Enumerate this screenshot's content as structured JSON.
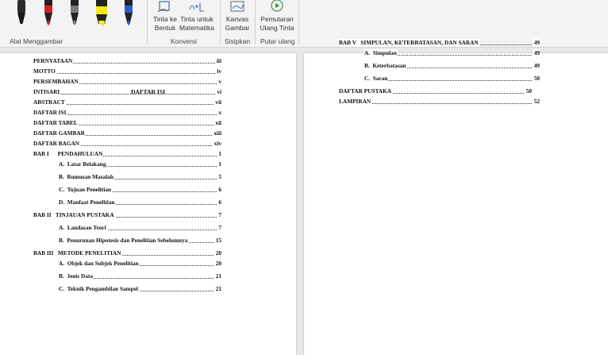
{
  "ribbon": {
    "pens": [
      {
        "icon": "black-pen-icon",
        "color": "#1a1a1a"
      },
      {
        "icon": "red-pen-icon",
        "color": "#d42020"
      },
      {
        "icon": "gray-pen-icon",
        "color": "#6e6e6e"
      },
      {
        "icon": "yellow-highlighter-icon",
        "color": "#f4e81a"
      },
      {
        "icon": "blue-pen-icon",
        "color": "#2a5bd7"
      }
    ],
    "groups": {
      "drawing_tools": "Alat Menggambar",
      "convert": "Konversi",
      "insert": "Sisipkan",
      "replay": "Putar ulang"
    },
    "buttons": {
      "ink_to_shape": "Tinta ke\nBentuk",
      "ink_to_math": "Tinta untuk\nMatematika",
      "canvas": "Kanvas\nGambar",
      "ink_replay": "Pemutaran\nUlang Tinta"
    }
  },
  "left_page": {
    "title": "DAFTAR ISI",
    "entries": [
      {
        "label": "PERNYATAAN",
        "page": "iii"
      },
      {
        "label": "MOTTO",
        "page": "iv"
      },
      {
        "label": "PERSEMBAHAN",
        "page": "v"
      },
      {
        "label": "INTISARI",
        "page": "vi"
      },
      {
        "label": "ABSTRACT",
        "page": "vii"
      },
      {
        "label": "DAFTAR ISI",
        "page": "x"
      },
      {
        "label": "DAFTAR TABEL",
        "page": "xii"
      },
      {
        "label": "DAFTAR GAMBAR",
        "page": "xiii"
      },
      {
        "label": "DAFTAR BAGAN",
        "page": "xiv"
      },
      {
        "label": "BAB I      PENDAHULUAN",
        "page": "1"
      },
      {
        "label": "A.  Latar Belakang",
        "page": "1"
      },
      {
        "label": "B.  Rumusan Masalah",
        "page": "5"
      },
      {
        "label": "C.  Tujuan Penelitian",
        "page": "6"
      },
      {
        "label": "D.  Manfaat Penelitian",
        "page": "6"
      },
      {
        "label": "BAB II   TINJAUAN PUSTAKA",
        "page": "7"
      },
      {
        "label": "A.  Landasan Teori",
        "page": "7"
      },
      {
        "label": "B.  Penurunan Hipotesis dan Penelitian Sebelumnya",
        "page": "15"
      },
      {
        "label": "BAB III   METODE PENELITIAN",
        "page": "20"
      },
      {
        "label": "A.  Objek dan Subjek Penelitian",
        "page": "20"
      },
      {
        "label": "B.  Jenis Data",
        "page": "21"
      },
      {
        "label": "C.  Teknik Pengambilan Sampel",
        "page": "21"
      }
    ]
  },
  "right_page": {
    "entries": [
      {
        "label": "BAB V   SIMPULAN, KETERBATASAN, DAN SARAN",
        "page": "49"
      },
      {
        "label": "A.  Simpulan",
        "page": "49"
      },
      {
        "label": "B.  Keterbatasan",
        "page": "49"
      },
      {
        "label": "C.  Saran",
        "page": "50"
      },
      {
        "label": "DAFTAR PUSTAKA",
        "page": "50"
      },
      {
        "label": "LAMPIRAN",
        "page": "52"
      }
    ]
  }
}
